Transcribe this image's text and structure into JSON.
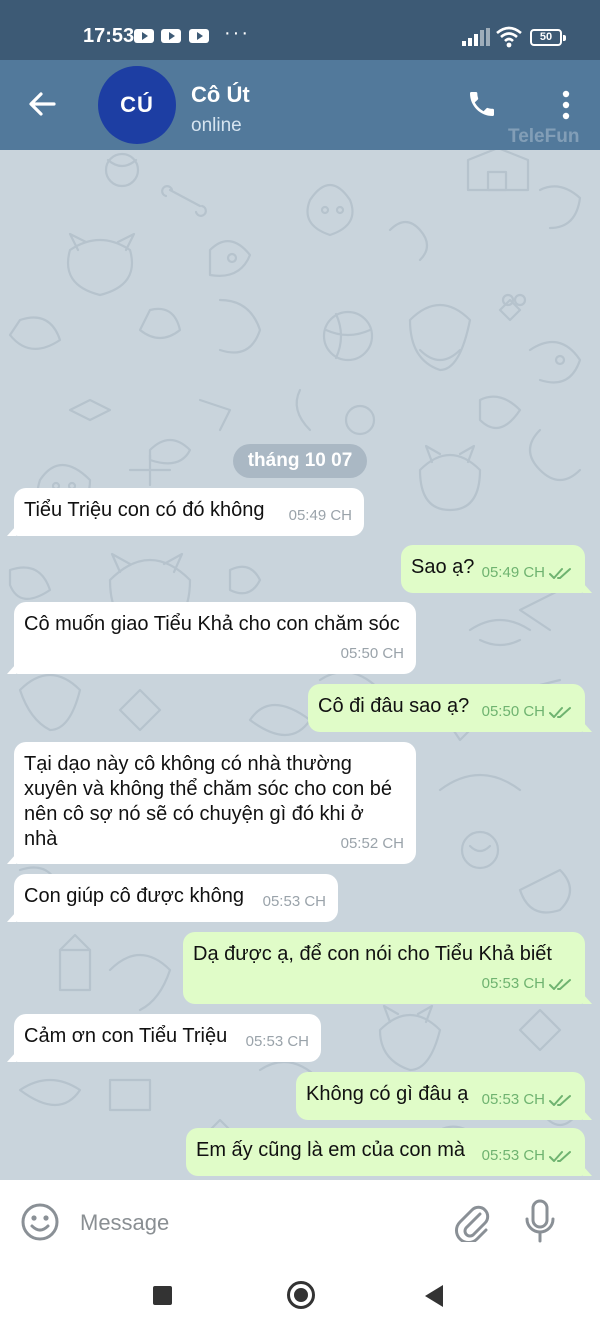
{
  "status_bar": {
    "time": "17:53",
    "more": "···",
    "battery": "50",
    "icons": [
      "youtube-icon",
      "youtube-icon",
      "youtube-icon",
      "signal-icon",
      "wifi-icon",
      "battery-icon"
    ]
  },
  "header": {
    "avatar_initials": "CÚ",
    "avatar_color": "#1d3ea3",
    "name": "Cô Út",
    "status": "online",
    "watermark": "TeleFun",
    "bar_color": "#52799b",
    "icons": [
      "back-arrow-icon",
      "phone-icon",
      "more-vert-icon"
    ]
  },
  "chat": {
    "date": "tháng 10 07",
    "messages": [
      {
        "direction": "in",
        "text": "Tiểu Triệu con có đó không",
        "time": "05:49 CH"
      },
      {
        "direction": "out",
        "text": "Sao ạ?",
        "time": "05:49 CH",
        "read": true
      },
      {
        "direction": "in",
        "text": "Cô muốn giao Tiểu Khả cho con chăm sóc",
        "time": "05:50 CH"
      },
      {
        "direction": "out",
        "text": "Cô đi đâu sao ạ?",
        "time": "05:50 CH",
        "read": true
      },
      {
        "direction": "in",
        "text": "Tại dạo này cô không có nhà thường xuyên và không thể chăm sóc cho con bé nên cô sợ nó sẽ có chuyện gì đó khi ở nhà",
        "time": "05:52 CH"
      },
      {
        "direction": "in",
        "text": "Con giúp cô được không",
        "time": "05:53 CH"
      },
      {
        "direction": "out",
        "text": "Dạ được ạ, để con nói cho Tiểu Khả biết",
        "time": "05:53 CH",
        "read": true
      },
      {
        "direction": "in",
        "text": "Cảm ơn con Tiểu Triệu",
        "time": "05:53 CH"
      },
      {
        "direction": "out",
        "text": "Không có gì đâu ạ",
        "time": "05:53 CH",
        "read": true
      },
      {
        "direction": "out",
        "text": "Em ấy cũng là em của con mà",
        "time": "05:53 CH",
        "read": true
      }
    ],
    "outgoing_bubble_color": "#e0fcc8",
    "incoming_bubble_color": "#ffffff"
  },
  "composer": {
    "placeholder": "Message",
    "value": "",
    "icons": [
      "emoji-icon",
      "attach-icon",
      "mic-icon"
    ]
  },
  "nav_bar": {
    "icons": [
      "recent-apps-icon",
      "home-icon",
      "nav-back-icon"
    ]
  }
}
